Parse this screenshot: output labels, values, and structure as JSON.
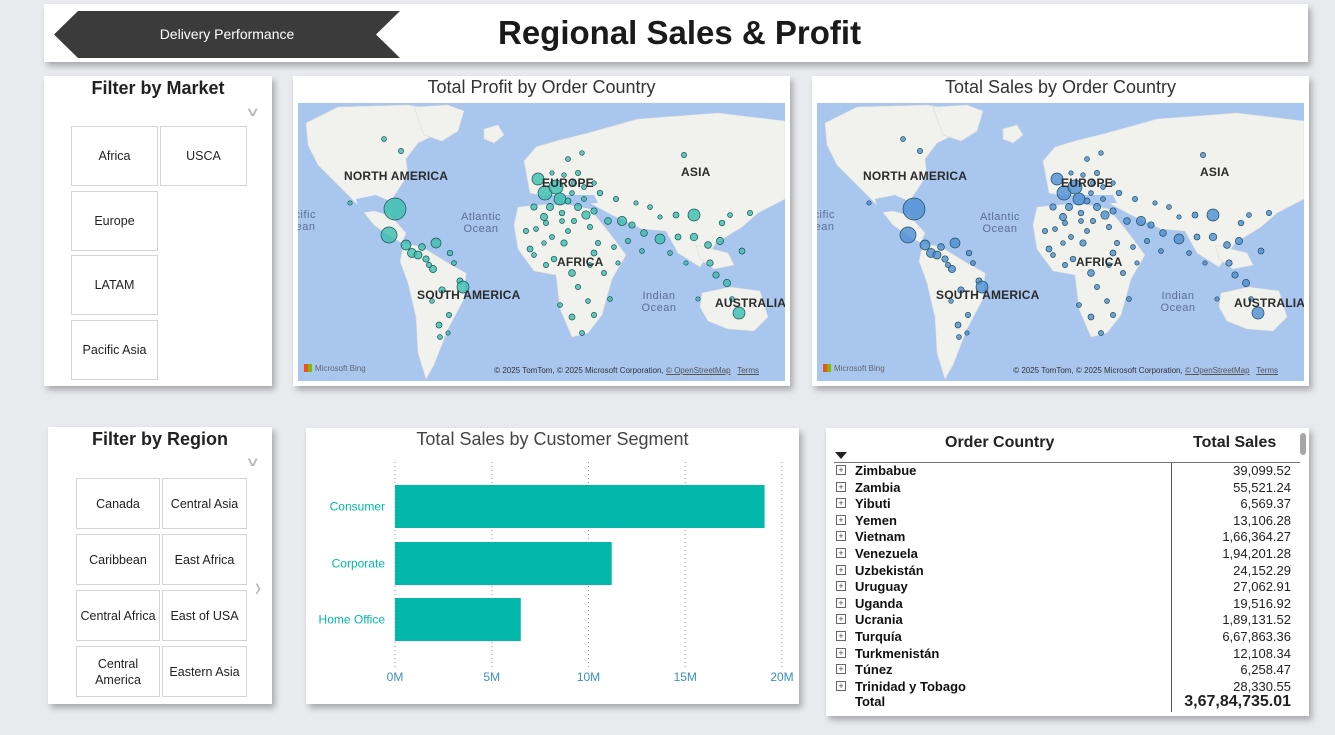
{
  "header": {
    "nav_button_label": "Delivery Performance",
    "title": "Regional Sales & Profit"
  },
  "market_filter": {
    "title": "Filter by Market",
    "items": [
      "Africa",
      "USCA",
      "Europe",
      "LATAM",
      "Pacific Asia"
    ]
  },
  "region_filter": {
    "title": "Filter by Region",
    "items": [
      "Canada",
      "Central Asia",
      "Caribbean",
      "East Africa",
      "Central Africa",
      "East of USA",
      "Central America",
      "Eastern Asia"
    ]
  },
  "maps": {
    "profit_title": "Total Profit by Order Country",
    "sales_title": "Total Sales by Order Country",
    "continent_labels": [
      "NORTH AMERICA",
      "EUROPE",
      "ASIA",
      "AFRICA",
      "SOUTH AMERICA",
      "AUSTRALIA"
    ],
    "ocean_labels": [
      "Atlantic Ocean",
      "Indian Ocean",
      "Pacific Ocean"
    ],
    "bing_label": "Microsoft Bing",
    "attribution": "© 2025 TomTom, © 2025 Microsoft Corporation,",
    "osm_link": "© OpenStreetMap",
    "terms_link": "Terms",
    "profit_bubble_color": "#3cc0ae",
    "sales_bubble_color": "#4e8fd6"
  },
  "segment_chart": {
    "title": "Total Sales by Customer Segment",
    "bar_color": "#01b8aa",
    "axis_label_color": "#3c8fc8",
    "chart_data": {
      "type": "bar",
      "orientation": "horizontal",
      "categories": [
        "Consumer",
        "Corporate",
        "Home Office"
      ],
      "values": [
        19.1,
        11.2,
        6.5
      ],
      "value_unit": "M",
      "xlim": [
        0,
        20
      ],
      "xticks": [
        "0M",
        "5M",
        "10M",
        "15M",
        "20M"
      ],
      "grid": true
    }
  },
  "country_table": {
    "headers": [
      "Order Country",
      "Total Sales"
    ],
    "rows": [
      {
        "country": "Zimbabue",
        "sales": "39,099.52"
      },
      {
        "country": "Zambia",
        "sales": "55,521.24"
      },
      {
        "country": "Yibuti",
        "sales": "6,569.37"
      },
      {
        "country": "Yemen",
        "sales": "13,106.28"
      },
      {
        "country": "Vietnam",
        "sales": "1,66,364.27"
      },
      {
        "country": "Venezuela",
        "sales": "1,94,201.28"
      },
      {
        "country": "Uzbekistán",
        "sales": "24,152.29"
      },
      {
        "country": "Uruguay",
        "sales": "27,062.91"
      },
      {
        "country": "Uganda",
        "sales": "19,516.92"
      },
      {
        "country": "Ucrania",
        "sales": "1,89,131.52"
      },
      {
        "country": "Turquía",
        "sales": "6,67,863.36"
      },
      {
        "country": "Turkmenistán",
        "sales": "12,108.34"
      },
      {
        "country": "Túnez",
        "sales": "6,258.47"
      },
      {
        "country": "Trinidad y Tobago",
        "sales": "28,330.55"
      }
    ],
    "total_label": "Total",
    "total_value": "3,67,84,735.01"
  }
}
